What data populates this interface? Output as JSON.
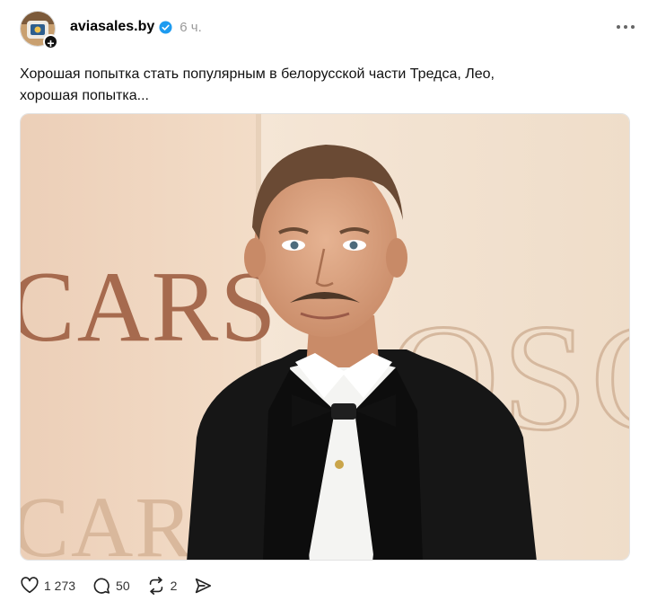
{
  "post": {
    "author": {
      "username": "aviasales.by",
      "verified_icon": "verified-check-icon",
      "time": "6 ч."
    },
    "caption_lines": [
      "Хорошая попытка стать популярным в белорусской части Тредса, Лео,",
      "хорошая попытка..."
    ],
    "image": {
      "backdrop_text_left_top": "CARS",
      "backdrop_text_left_bottom": "CARS",
      "backdrop_text_right": "OSC"
    },
    "actions": {
      "like_count": "1 273",
      "reply_count": "50",
      "repost_count": "2"
    }
  },
  "colors": {
    "verified": "#1d9bf0",
    "backdrop": "#efd6c0",
    "backdrop_text": "#a66a4e",
    "suit": "#161616"
  }
}
